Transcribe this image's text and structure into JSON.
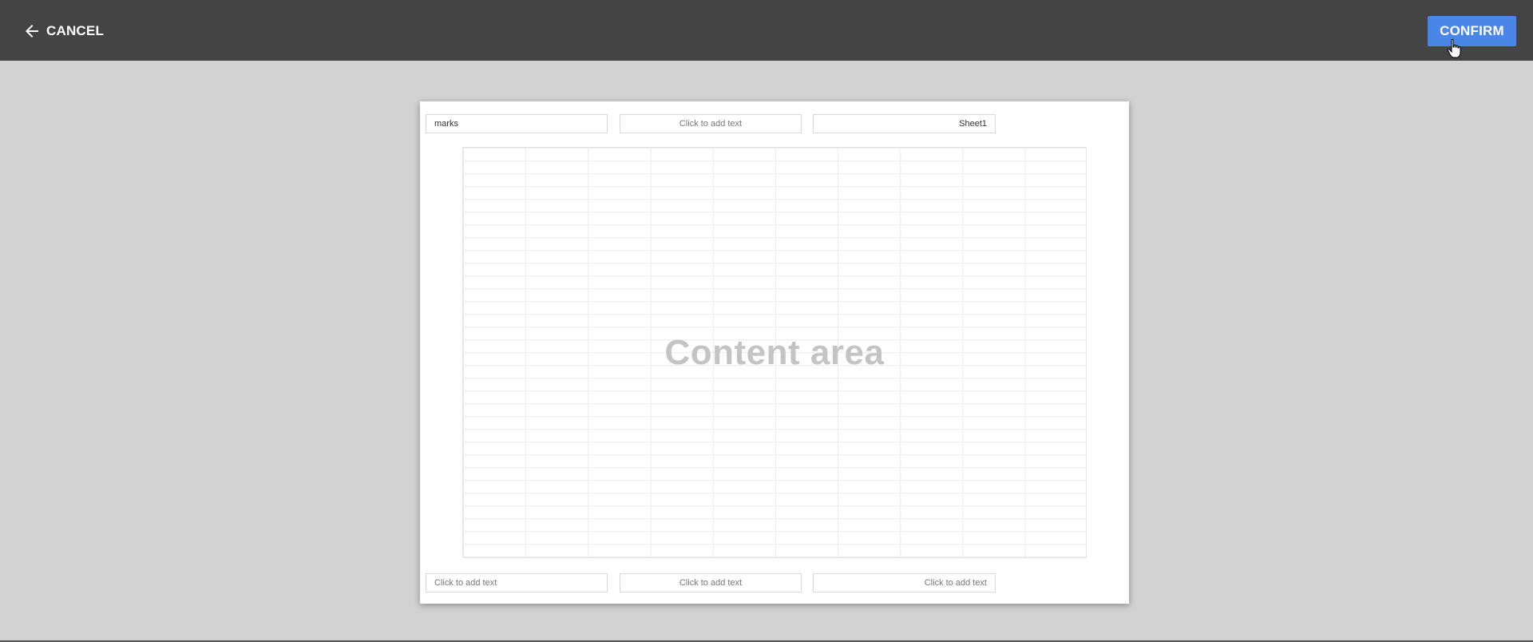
{
  "topbar": {
    "cancel_label": "CANCEL",
    "confirm_label": "CONFIRM",
    "background_color": "#444444",
    "confirm_color": "#4a86e8"
  },
  "page": {
    "header": {
      "left": "marks",
      "center": "Click to add text",
      "right": "Sheet1"
    },
    "footer": {
      "left": "Click to add text",
      "center": "Click to add text",
      "right": "Click to add text"
    },
    "content_label": "Content area"
  }
}
